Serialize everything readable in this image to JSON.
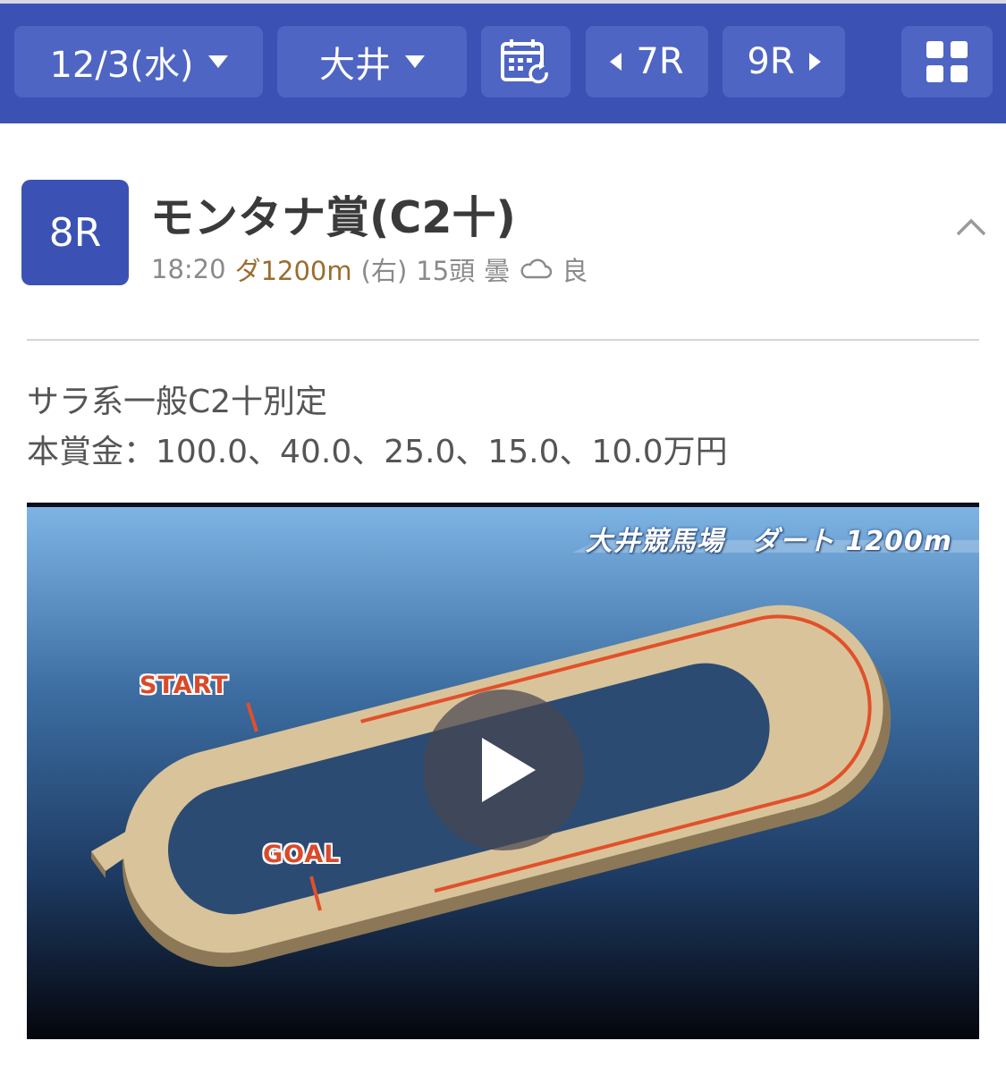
{
  "topbar": {
    "date_label": "12/3(水)",
    "venue_label": "大井",
    "calendar_icon": "calendar-refresh-icon",
    "prev_race_label": "7R",
    "next_race_label": "9R",
    "menu_icon": "grid-icon",
    "colors": {
      "bar": "#3b52b4",
      "button": "#4f65c3"
    }
  },
  "race": {
    "number": "8R",
    "title": "モンタナ賞(C2十)",
    "start_time": "18:20",
    "distance": "ダ1200m",
    "direction": "(右)",
    "runners": "15頭",
    "weather": "曇",
    "weather_icon": "cloud-icon",
    "track_condition": "良"
  },
  "conditions": {
    "line1": "サラ系一般C2十別定",
    "line2": "本賞金：100.0、40.0、25.0、15.0、10.0万円"
  },
  "video": {
    "course_title": "大井競馬場　ダート 1200m",
    "start_label": "START",
    "goal_label": "GOAL",
    "play_icon": "play-icon"
  }
}
